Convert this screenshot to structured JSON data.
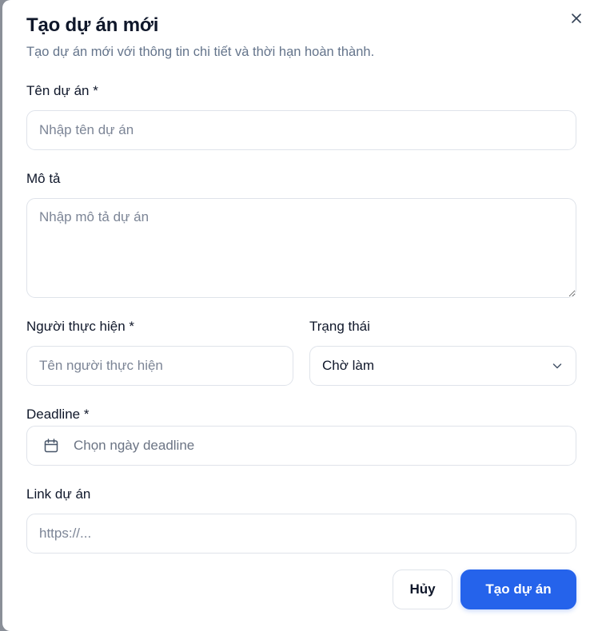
{
  "dialog": {
    "title": "Tạo dự án mới",
    "subtitle": "Tạo dự án mới với thông tin chi tiết và thời hạn hoàn thành.",
    "close_icon": "close-icon"
  },
  "form": {
    "name": {
      "label": "Tên dự án *",
      "placeholder": "Nhập tên dự án",
      "value": ""
    },
    "description": {
      "label": "Mô tả",
      "placeholder": "Nhập mô tả dự án",
      "value": ""
    },
    "assignee": {
      "label": "Người thực hiện *",
      "placeholder": "Tên người thực hiện",
      "value": ""
    },
    "status": {
      "label": "Trạng thái",
      "value": "Chờ làm",
      "icon": "chevron-down-icon"
    },
    "deadline": {
      "label": "Deadline *",
      "placeholder": "Chọn ngày deadline",
      "icon": "calendar-icon"
    },
    "link": {
      "label": "Link dự án",
      "placeholder": "https://...",
      "value": ""
    }
  },
  "actions": {
    "cancel_label": "Hủy",
    "submit_label": "Tạo dự án"
  },
  "colors": {
    "primary": "#2563eb",
    "border": "#dfe3ea",
    "text": "#0f172a",
    "muted": "#64748b"
  }
}
